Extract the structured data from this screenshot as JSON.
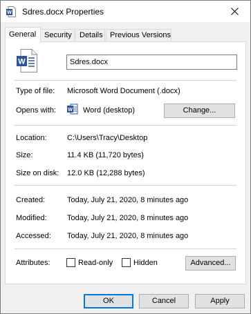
{
  "window": {
    "title": "Sdres.docx Properties"
  },
  "tabs": [
    {
      "label": "General"
    },
    {
      "label": "Security"
    },
    {
      "label": "Details"
    },
    {
      "label": "Previous Versions"
    }
  ],
  "file": {
    "name": "Sdres.docx"
  },
  "type_of_file": {
    "label": "Type of file:",
    "value": "Microsoft Word Document (.docx)"
  },
  "opens_with": {
    "label": "Opens with:",
    "value": "Word (desktop)",
    "button": "Change..."
  },
  "location": {
    "label": "Location:",
    "value": "C:\\Users\\Tracy\\Desktop"
  },
  "size": {
    "label": "Size:",
    "value": "11.4 KB (11,720 bytes)"
  },
  "size_on_disk": {
    "label": "Size on disk:",
    "value": "12.0 KB (12,288 bytes)"
  },
  "created": {
    "label": "Created:",
    "value": "Today, July 21, 2020, 8 minutes ago"
  },
  "modified": {
    "label": "Modified:",
    "value": "Today, July 21, 2020, 8 minutes ago"
  },
  "accessed": {
    "label": "Accessed:",
    "value": "Today, July 21, 2020, 8 minutes ago"
  },
  "attributes": {
    "label": "Attributes:",
    "readonly": "Read-only",
    "hidden": "Hidden",
    "advanced_button": "Advanced..."
  },
  "footer": {
    "ok": "OK",
    "cancel": "Cancel",
    "apply": "Apply"
  },
  "colors": {
    "word_blue": "#2b579a",
    "accent": "#0078d7"
  }
}
